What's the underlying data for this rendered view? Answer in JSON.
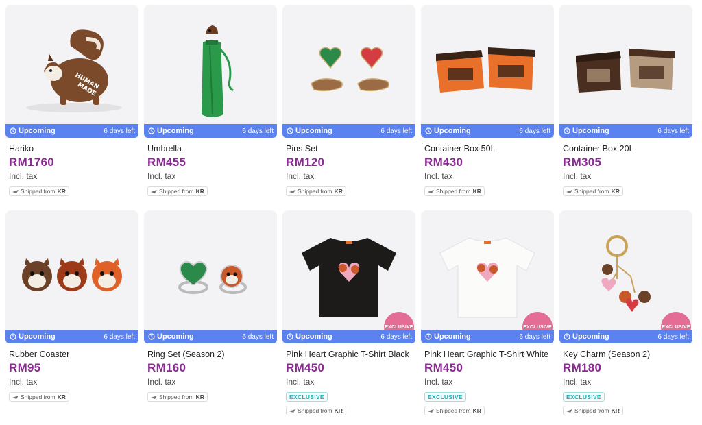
{
  "colors": {
    "status_bar": "#5b82ee",
    "price": "#8a2a93",
    "exclusive_badge": "#e36d94",
    "exclusive_chip": "#14b3b8",
    "thumb_bg": "#f3f3f5"
  },
  "products": [
    {
      "name": "Hariko",
      "price": "RM1760",
      "tax": "Incl. tax",
      "status": "Upcoming",
      "time_left": "6 days left",
      "ship_prefix": "Shipped from",
      "ship_country": "KR",
      "image_icon": "squirrel-figure-icon"
    },
    {
      "name": "Umbrella",
      "price": "RM455",
      "tax": "Incl. tax",
      "status": "Upcoming",
      "time_left": "6 days left",
      "ship_prefix": "Shipped from",
      "ship_country": "KR",
      "image_icon": "umbrella-icon"
    },
    {
      "name": "Pins Set",
      "price": "RM120",
      "tax": "Incl. tax",
      "status": "Upcoming",
      "time_left": "6 days left",
      "ship_prefix": "Shipped from",
      "ship_country": "KR",
      "image_icon": "pins-icon"
    },
    {
      "name": "Container Box 50L",
      "price": "RM430",
      "tax": "Incl. tax",
      "status": "Upcoming",
      "time_left": "6 days left",
      "ship_prefix": "Shipped from",
      "ship_country": "KR",
      "image_icon": "orange-box-icon"
    },
    {
      "name": "Container Box 20L",
      "price": "RM305",
      "tax": "Incl. tax",
      "status": "Upcoming",
      "time_left": "6 days left",
      "ship_prefix": "Shipped from",
      "ship_country": "KR",
      "image_icon": "brown-box-icon"
    },
    {
      "name": "Rubber Coaster",
      "price": "RM95",
      "tax": "Incl. tax",
      "status": "Upcoming",
      "time_left": "6 days left",
      "ship_prefix": "Shipped from",
      "ship_country": "KR",
      "image_icon": "coaster-icon"
    },
    {
      "name": "Ring Set (Season 2)",
      "price": "RM160",
      "tax": "Incl. tax",
      "status": "Upcoming",
      "time_left": "6 days left",
      "ship_prefix": "Shipped from",
      "ship_country": "KR",
      "image_icon": "ring-icon"
    },
    {
      "name": "Pink Heart Graphic T-Shirt Black",
      "price": "RM450",
      "tax": "Incl. tax",
      "status": "Upcoming",
      "time_left": "6 days left",
      "exclusive_badge": "EXCLUSIVE",
      "exclusive_chip": "EXCLUSIVE",
      "ship_prefix": "Shipped from",
      "ship_country": "KR",
      "image_icon": "black-tshirt-icon"
    },
    {
      "name": "Pink Heart Graphic T-Shirt White",
      "price": "RM450",
      "tax": "Incl. tax",
      "status": "Upcoming",
      "time_left": "6 days left",
      "exclusive_badge": "EXCLUSIVE",
      "exclusive_chip": "EXCLUSIVE",
      "ship_prefix": "Shipped from",
      "ship_country": "KR",
      "image_icon": "white-tshirt-icon"
    },
    {
      "name": "Key Charm (Season 2)",
      "price": "RM180",
      "tax": "Incl. tax",
      "status": "Upcoming",
      "time_left": "6 days left",
      "exclusive_badge": "EXCLUSIVE",
      "exclusive_chip": "EXCLUSIVE",
      "ship_prefix": "Shipped from",
      "ship_country": "KR",
      "image_icon": "key-charm-icon"
    }
  ]
}
